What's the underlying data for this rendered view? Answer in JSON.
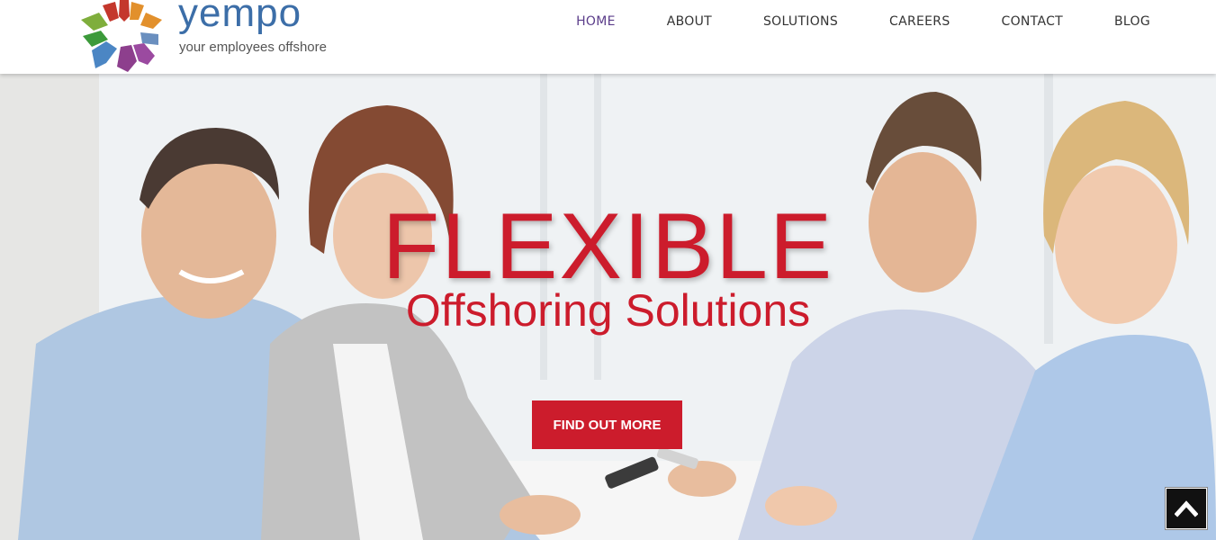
{
  "brand": {
    "name": "yempo",
    "tagline": "your employees offshore",
    "colors": {
      "blue": "#3c6ea8",
      "red": "#cc1c2c",
      "purple": "#5b3d8a"
    }
  },
  "nav": {
    "items": [
      {
        "label": "HOME",
        "active": true
      },
      {
        "label": "ABOUT",
        "active": false
      },
      {
        "label": "SOLUTIONS",
        "active": false
      },
      {
        "label": "CAREERS",
        "active": false
      },
      {
        "label": "CONTACT",
        "active": false
      },
      {
        "label": "BLOG",
        "active": false
      }
    ]
  },
  "hero": {
    "title": "FLEXIBLE",
    "subtitle": "Offshoring Solutions",
    "cta_label": "FIND OUT MORE",
    "accent_color": "#cc1c2c"
  },
  "icons": {
    "back_to_top": "chevron-up-icon"
  }
}
